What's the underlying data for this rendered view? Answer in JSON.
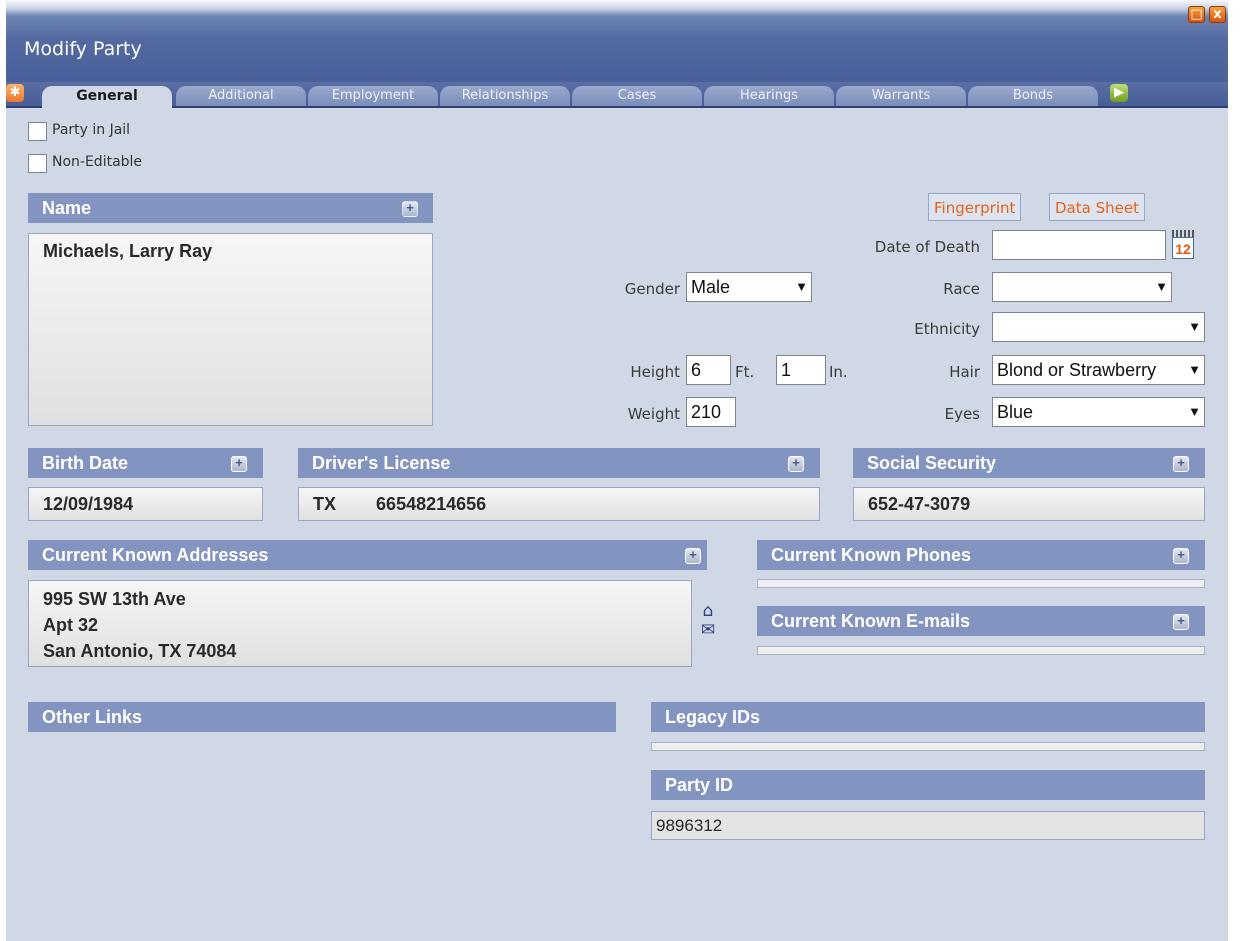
{
  "window": {
    "title": "Modify Party",
    "maximize_icon": "□",
    "close_icon": "x"
  },
  "tabs": {
    "prev_icon": "✱",
    "next_icon": "▶",
    "items": [
      "General",
      "Additional",
      "Employment",
      "Relationships",
      "Cases",
      "Hearings",
      "Warrants",
      "Bonds"
    ],
    "active": "General"
  },
  "checkboxes": {
    "party_in_jail": "Party in Jail",
    "non_editable": "Non-Editable"
  },
  "name": {
    "header": "Name",
    "value": "Michaels, Larry Ray"
  },
  "buttons": {
    "fingerprint": "Fingerprint",
    "data_sheet": "Data Sheet"
  },
  "calendar_icon": {
    "number": "12"
  },
  "fields": {
    "date_of_death": {
      "label": "Date of Death",
      "value": ""
    },
    "gender": {
      "label": "Gender",
      "value": "Male"
    },
    "race": {
      "label": "Race",
      "value": ""
    },
    "ethnicity": {
      "label": "Ethnicity",
      "value": ""
    },
    "height": {
      "label": "Height",
      "feet": "6",
      "feet_unit": "Ft.",
      "inches": "1",
      "inches_unit": "In."
    },
    "weight": {
      "label": "Weight",
      "value": "210"
    },
    "hair": {
      "label": "Hair",
      "value": "Blond or Strawberry"
    },
    "eyes": {
      "label": "Eyes",
      "value": "Blue"
    }
  },
  "birth_date": {
    "header": "Birth Date",
    "value": "12/09/1984"
  },
  "drivers_license": {
    "header": "Driver's License",
    "state": "TX",
    "number": "66548214656"
  },
  "social_security": {
    "header": "Social Security",
    "value": "652-47-3079"
  },
  "addresses": {
    "header": "Current Known Addresses",
    "line1": "995 SW 13th Ave",
    "line2": "Apt 32",
    "line3": "San Antonio, TX 74084",
    "home_icon": "⌂",
    "mail_icon": "✉"
  },
  "phones": {
    "header": "Current Known Phones"
  },
  "emails": {
    "header": "Current Known E-mails"
  },
  "other_links": {
    "header": "Other Links"
  },
  "legacy_ids": {
    "header": "Legacy IDs"
  },
  "party_id": {
    "header": "Party ID",
    "value": "9896312"
  },
  "plus_icon": "+",
  "dropdown_arrow": "▼",
  "colors": {
    "section_header": "#8394c0",
    "titlebar": "#4a6099",
    "link": "#e2631b",
    "background": "#d0d8e5"
  }
}
